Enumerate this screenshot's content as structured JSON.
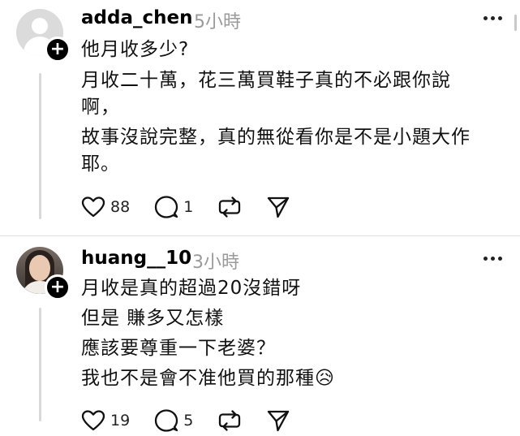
{
  "comments": [
    {
      "username": "adda_chen",
      "time": "5小時",
      "lines": [
        "他月收多少?",
        "月收二十萬，花三萬買鞋子真的不必跟你說",
        "啊，",
        "故事沒說完整，真的無從看你是不是小題大作",
        "耶。"
      ],
      "likes": "88",
      "replies": "1"
    },
    {
      "username": "huang__10",
      "time": "3小時",
      "lines": [
        "月收是真的超過20沒錯呀",
        "但是 賺多又怎樣",
        "應該要尊重一下老婆？",
        "我也不是會不准他買的那種"
      ],
      "emoji": "😥",
      "likes": "19",
      "replies": "5"
    }
  ],
  "icons": {
    "like": "heart-icon",
    "reply": "comment-icon",
    "repost": "repost-icon",
    "share": "send-icon",
    "more": "more-icon",
    "follow": "plus-icon"
  }
}
